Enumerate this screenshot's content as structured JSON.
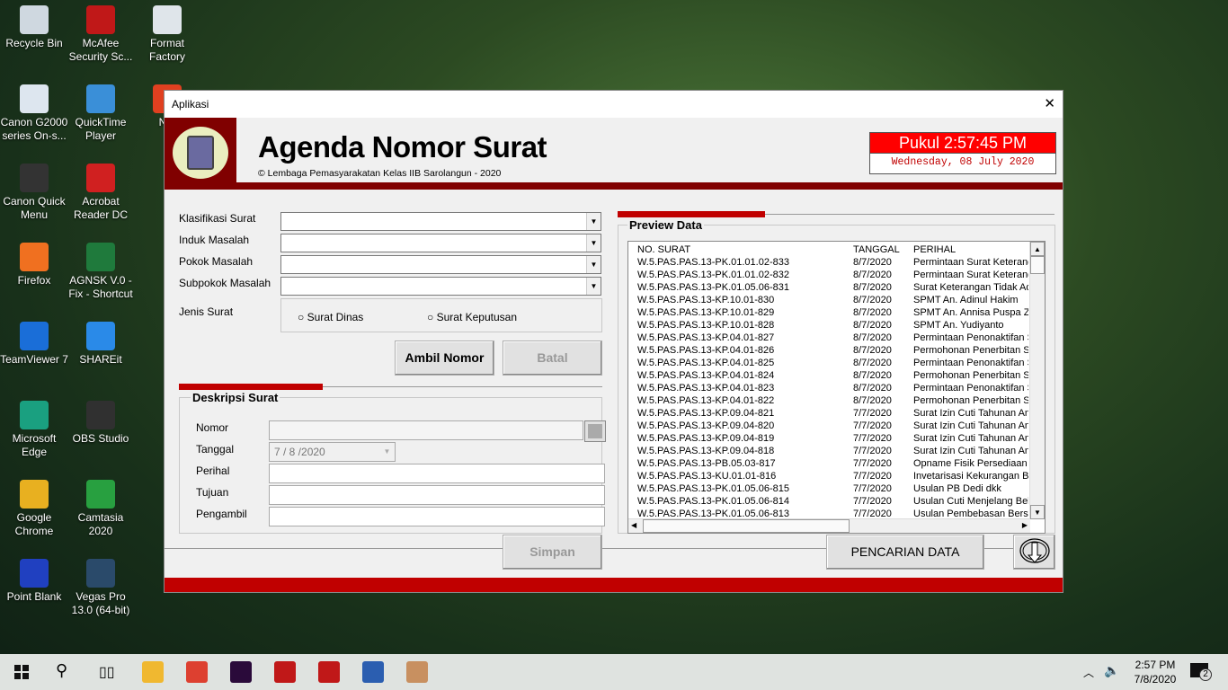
{
  "desktop": {
    "icons": [
      {
        "label": "Recycle Bin",
        "color": "#cfd8e0"
      },
      {
        "label": "McAfee Security Sc...",
        "color": "#c01818"
      },
      {
        "label": "Format Factory",
        "color": "#dfe5ea"
      },
      {
        "label": "Canon G2000 series On-s...",
        "color": "#dde6ef"
      },
      {
        "label": "QuickTime Player",
        "color": "#3a8fd8"
      },
      {
        "label": "Nitr",
        "color": "#e04020"
      },
      {
        "label": "Canon Quick Menu",
        "color": "#333"
      },
      {
        "label": "Acrobat Reader DC",
        "color": "#d02020"
      },
      {
        "label": "Firefox",
        "color": "#f07020"
      },
      {
        "label": "AGNSK V.0 - Fix - Shortcut",
        "color": "#1f7a3c"
      },
      {
        "label": "TeamViewer 7",
        "color": "#1a6ed8"
      },
      {
        "label": "SHAREit",
        "color": "#2a8ae8"
      },
      {
        "label": "Microsoft Edge",
        "color": "#1aa080"
      },
      {
        "label": "OBS Studio",
        "color": "#303030"
      },
      {
        "label": "Google Chrome",
        "color": "#e8b020"
      },
      {
        "label": "Camtasia 2020",
        "color": "#28a040"
      },
      {
        "label": "Point Blank",
        "color": "#2040c0"
      },
      {
        "label": "Vegas Pro 13.0 (64-bit)",
        "color": "#2a4a6a"
      }
    ]
  },
  "window": {
    "title": "Aplikasi",
    "close": "✕"
  },
  "header": {
    "title": "Agenda Nomor Surat",
    "subtitle": "© Lembaga Pemasyarakatan Kelas IIB Sarolangun - 2020",
    "clock": "Pukul 2:57:45 PM",
    "date": "Wednesday, 08 July 2020",
    "accent": "#800000",
    "clock_bg": "#ff0000"
  },
  "form": {
    "klasifikasi": "Klasifikasi Surat",
    "induk": "Induk Masalah",
    "pokok": "Pokok Masalah",
    "subpokok": "Subpokok Masalah",
    "jenis": "Jenis Surat",
    "radio1": "Surat Dinas",
    "radio2": "Surat Keputusan",
    "ambil": "Ambil Nomor",
    "batal": "Batal"
  },
  "deskripsi": {
    "title": "Deskripsi Surat",
    "nomor": "Nomor",
    "tanggal": "Tanggal",
    "tanggal_value": "7 / 8 /2020",
    "perihal": "Perihal",
    "tujuan": "Tujuan",
    "pengambil": "Pengambil",
    "simpan": "Simpan"
  },
  "preview": {
    "title": "Preview Data",
    "headers": [
      "NO. SURAT",
      "TANGGAL",
      "PERIHAL"
    ],
    "rows": [
      [
        "W.5.PAS.PAS.13-PK.01.01.02-833",
        "8/7/2020",
        "Permintaan Surat Keterang"
      ],
      [
        "W.5.PAS.PAS.13-PK.01.01.02-832",
        "8/7/2020",
        "Permintaan Surat Keterang"
      ],
      [
        "W.5.PAS.PAS.13-PK.01.05.06-831",
        "8/7/2020",
        "Surat Keterangan Tidak Ad"
      ],
      [
        "W.5.PAS.PAS.13-KP.10.01-830",
        "8/7/2020",
        "SPMT An. Adinul Hakim"
      ],
      [
        "W.5.PAS.PAS.13-KP.10.01-829",
        "8/7/2020",
        "SPMT An. Annisa Puspa Z"
      ],
      [
        "W.5.PAS.PAS.13-KP.10.01-828",
        "8/7/2020",
        "SPMT An. Yudiyanto"
      ],
      [
        "W.5.PAS.PAS.13-KP.04.01-827",
        "8/7/2020",
        "Permintaan Penonaktifan S"
      ],
      [
        "W.5.PAS.PAS.13-KP.04.01-826",
        "8/7/2020",
        "Permohonan Penerbitan SK"
      ],
      [
        "W.5.PAS.PAS.13-KP.04.01-825",
        "8/7/2020",
        "Permintaan Penonaktifan S"
      ],
      [
        "W.5.PAS.PAS.13-KP.04.01-824",
        "8/7/2020",
        "Permohonan Penerbitan SK"
      ],
      [
        "W.5.PAS.PAS.13-KP.04.01-823",
        "8/7/2020",
        "Permintaan Penonaktifan S"
      ],
      [
        "W.5.PAS.PAS.13-KP.04.01-822",
        "8/7/2020",
        "Permohonan Penerbitan SK"
      ],
      [
        "W.5.PAS.PAS.13-KP.09.04-821",
        "7/7/2020",
        "Surat Izin Cuti Tahunan An"
      ],
      [
        "W.5.PAS.PAS.13-KP.09.04-820",
        "7/7/2020",
        "Surat Izin Cuti Tahunan An"
      ],
      [
        "W.5.PAS.PAS.13-KP.09.04-819",
        "7/7/2020",
        "Surat Izin Cuti Tahunan An"
      ],
      [
        "W.5.PAS.PAS.13-KP.09.04-818",
        "7/7/2020",
        "Surat Izin Cuti Tahunan An"
      ],
      [
        "W.5.PAS.PAS.13-PB.05.03-817",
        "7/7/2020",
        "Opname Fisik Persediaan"
      ],
      [
        "W.5.PAS.PAS.13-KU.01.01-816",
        "7/7/2020",
        "Invetarisasi Kekurangan Be"
      ],
      [
        "W.5.PAS.PAS.13-PK.01.05.06-815",
        "7/7/2020",
        "Usulan PB Dedi dkk"
      ],
      [
        "W.5.PAS.PAS.13-PK.01.05.06-814",
        "7/7/2020",
        "Usulan Cuti Menjelang Beba"
      ],
      [
        "W.5.PAS.PAS.13-PK.01.05.06-813",
        "7/7/2020",
        "Usulan Pembebasan Bersy"
      ]
    ],
    "search": "PENCARIAN DATA"
  },
  "taskbar": {
    "time": "2:57 PM",
    "date": "7/8/2020",
    "notifications": "2",
    "apps": [
      {
        "name": "file-explorer",
        "color": "#f0b830"
      },
      {
        "name": "chrome",
        "color": "#dd4030"
      },
      {
        "name": "premiere",
        "color": "#2a0a3a"
      },
      {
        "name": "acrobat",
        "color": "#c01818"
      },
      {
        "name": "mcafee",
        "color": "#c01818"
      },
      {
        "name": "word",
        "color": "#2b5eb0"
      },
      {
        "name": "paint",
        "color": "#c89060"
      }
    ]
  }
}
